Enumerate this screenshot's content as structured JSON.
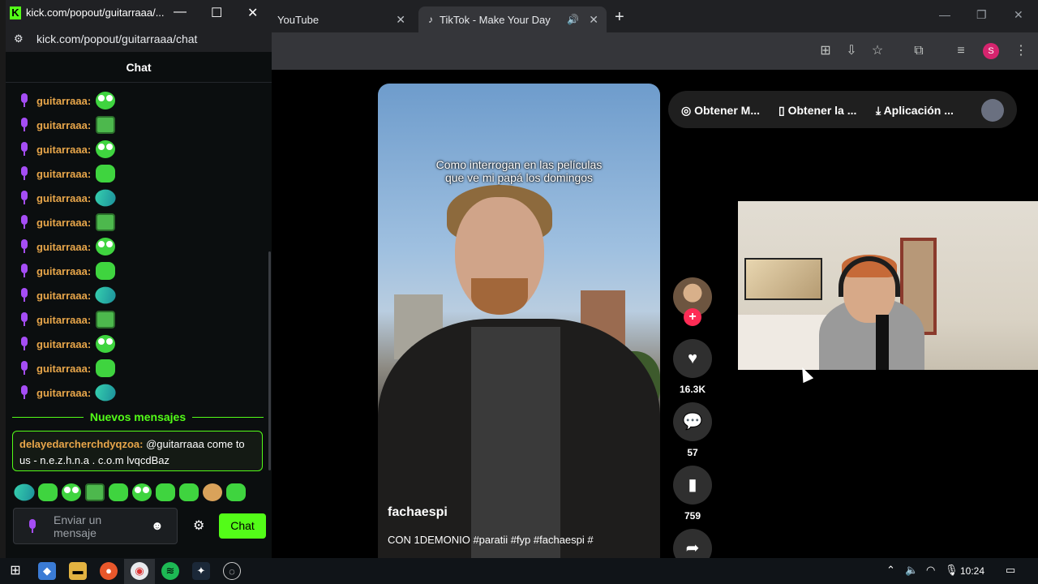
{
  "browser": {
    "tabs": [
      {
        "label": "YouTube"
      },
      {
        "label": "TikTok - Make Your Day"
      }
    ],
    "new_tab_symbol": "+",
    "profile_initial": "S"
  },
  "tiktok": {
    "topbar": {
      "btn1": "Obtener M...",
      "btn2": "Obtener la ...",
      "btn3": "Aplicación ..."
    },
    "video": {
      "caption_line1": "Como interrogan en las películas",
      "caption_line2": "que ve mi papá los domingos",
      "author": "fachaespi",
      "description": "CON 1DEMONIO #paratii #fyp #fachaespi #"
    },
    "actions": {
      "likes": "16.3K",
      "comments": "57",
      "saves": "759"
    }
  },
  "popup": {
    "window_title": "kick.com/popout/guitarraaa/...",
    "url": "kick.com/popout/guitarraaa/chat",
    "chat_title": "Chat",
    "messages": [
      {
        "user": "guitarraaa:",
        "emote": "eyes"
      },
      {
        "user": "guitarraaa:",
        "emote": "box"
      },
      {
        "user": "guitarraaa:",
        "emote": "eyes"
      },
      {
        "user": "guitarraaa:",
        "emote": "frog"
      },
      {
        "user": "guitarraaa:",
        "emote": "fish"
      },
      {
        "user": "guitarraaa:",
        "emote": "box"
      },
      {
        "user": "guitarraaa:",
        "emote": "eyes"
      },
      {
        "user": "guitarraaa:",
        "emote": "frog"
      },
      {
        "user": "guitarraaa:",
        "emote": "fish"
      },
      {
        "user": "guitarraaa:",
        "emote": "box"
      },
      {
        "user": "guitarraaa:",
        "emote": "eyes"
      },
      {
        "user": "guitarraaa:",
        "emote": "frog"
      },
      {
        "user": "guitarraaa:",
        "emote": "fish"
      }
    ],
    "new_messages_label": "Nuevos mensajes",
    "mention": {
      "user": "delayedarcherchdyqzoa:",
      "text": " @guitarraaa come to us - n.e.z.h.n.a . c.o.m lvqcdBaz"
    },
    "input_placeholder": "Enviar un mensaje",
    "send_label": "Chat"
  },
  "taskbar": {
    "clock": "10:24"
  },
  "colors": {
    "kick_green": "#53fc18",
    "username_orange": "#e8a64a",
    "tiktok_red": "#fe2c55"
  }
}
